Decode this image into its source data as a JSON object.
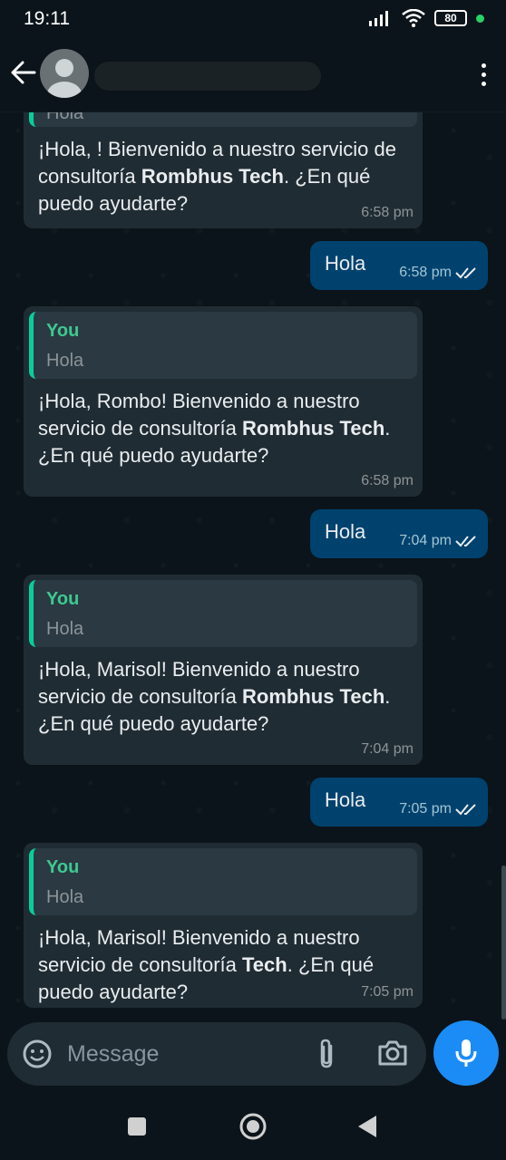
{
  "status": {
    "time": "19:11",
    "battery": "80"
  },
  "header": {
    "contact_name": ""
  },
  "messages": [
    {
      "type": "in",
      "quote": {
        "who": "",
        "text": "Hola"
      },
      "html": "¡Hola, ! Bienvenido a nuestro servicio de consultoría <b>Rombhus Tech</b>. ¿En qué puedo ayudarte?",
      "time": "6:58 pm"
    },
    {
      "type": "out",
      "text": "Hola",
      "time": "6:58 pm"
    },
    {
      "type": "in",
      "quote": {
        "who": "You",
        "text": "Hola"
      },
      "html": "¡Hola, Rombo! Bienvenido a nuestro servicio de consultoría <b>Rombhus Tech</b>. ¿En qué puedo ayudarte?",
      "time": "6:58 pm"
    },
    {
      "type": "out",
      "text": "Hola",
      "time": "7:04 pm"
    },
    {
      "type": "in",
      "quote": {
        "who": "You",
        "text": "Hola"
      },
      "html": "¡Hola, Marisol! Bienvenido a nuestro servicio de consultoría <b>Rombhus Tech</b>. ¿En qué puedo ayudarte?",
      "time": "7:04 pm"
    },
    {
      "type": "out",
      "text": "Hola",
      "time": "7:05 pm"
    },
    {
      "type": "in",
      "quote": {
        "who": "You",
        "text": "Hola"
      },
      "html": "¡Hola, Marisol! Bienvenido a nuestro servicio de consultoría <b>Tech</b>. ¿En qué puedo ayudarte?",
      "time": "7:05 pm"
    }
  ],
  "composer": {
    "placeholder": "Message"
  },
  "colors": {
    "accent_quote": "#06cf9c",
    "outgoing_bubble": "#00426e",
    "incoming_bubble": "#202c33",
    "mic_button": "#1b8cf5"
  },
  "icons": [
    "back-arrow-icon",
    "avatar-icon",
    "more-options-icon",
    "emoji-icon",
    "attach-icon",
    "camera-icon",
    "mic-icon",
    "nav-recents-icon",
    "nav-home-icon",
    "nav-back-icon"
  ]
}
